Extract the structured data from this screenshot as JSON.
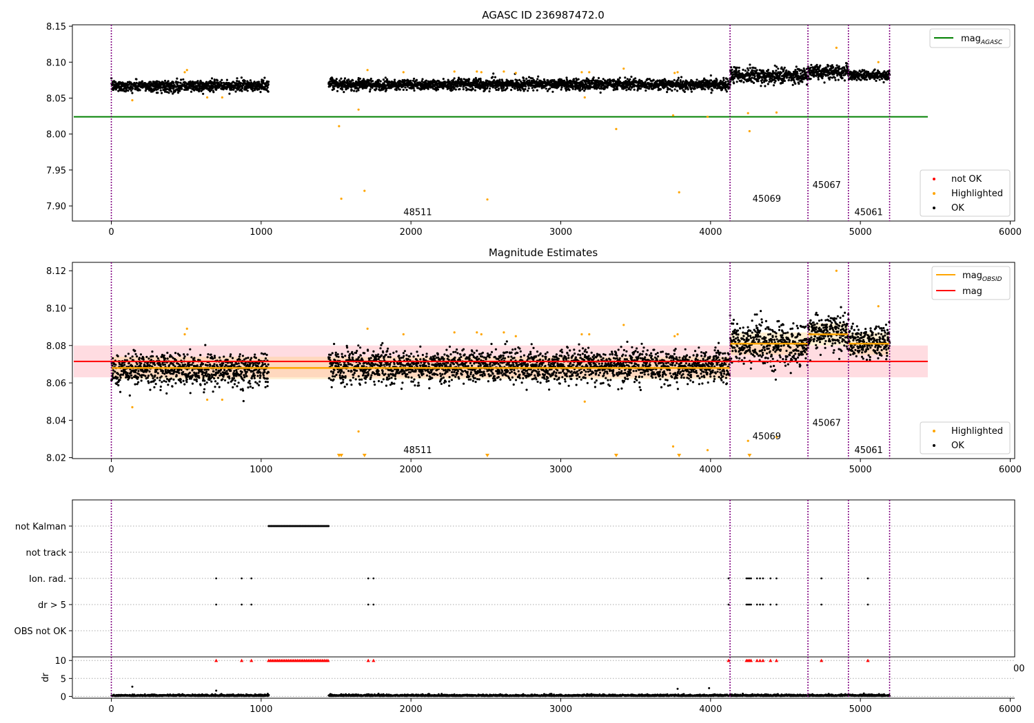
{
  "colors": {
    "ok": "#000000",
    "highlighted": "#ffa500",
    "not_ok": "#ff0000",
    "agasc_line": "#008000",
    "mag_line": "#ff0000",
    "obsid_line": "#ffa500",
    "obs_boundary": "#800080",
    "band": "#ffc0c8"
  },
  "chart_data": [
    {
      "type": "scatter",
      "title": "AGASC ID 236987472.0",
      "xlim": [
        -260,
        6030
      ],
      "ylim": [
        7.879,
        8.152
      ],
      "xticks": [
        0,
        1000,
        2000,
        3000,
        4000,
        5000,
        6000
      ],
      "yticks": [
        7.9,
        7.95,
        8.0,
        8.05,
        8.1,
        8.15
      ],
      "ytick_labels": [
        "7.90",
        "7.95",
        "8.00",
        "8.05",
        "8.10",
        "8.15"
      ],
      "mag_agasc": 8.024,
      "mag_agasc_xrange": [
        -260,
        5450
      ],
      "legend_upper": [
        {
          "label": "mag",
          "sub": "AGASC",
          "kind": "line",
          "color": "#008000"
        }
      ],
      "legend_lower": [
        {
          "label": "not OK",
          "kind": "dot",
          "color": "#ff0000"
        },
        {
          "label": "Highlighted",
          "kind": "dot",
          "color": "#ffa500"
        },
        {
          "label": "OK",
          "kind": "dot",
          "color": "#000000"
        }
      ],
      "observations": [
        {
          "id": "48511",
          "label_x": 1950,
          "label_y": 7.887
        },
        {
          "id": "45069",
          "label_x": 4280,
          "label_y": 7.906
        },
        {
          "id": "45067",
          "label_x": 4680,
          "label_y": 7.925
        },
        {
          "id": "45061",
          "label_x": 4960,
          "label_y": 7.887
        }
      ],
      "segments": [
        {
          "x0": 0,
          "x1": 1050,
          "center": 8.067,
          "spread": 0.007
        },
        {
          "x0": 1450,
          "x1": 4130,
          "center": 8.069,
          "spread": 0.007
        },
        {
          "x0": 4130,
          "x1": 4650,
          "center": 8.081,
          "spread": 0.009
        },
        {
          "x0": 4650,
          "x1": 4920,
          "center": 8.087,
          "spread": 0.008
        },
        {
          "x0": 4920,
          "x1": 5195,
          "center": 8.082,
          "spread": 0.006
        }
      ],
      "highlighted": [
        [
          140,
          8.047
        ],
        [
          490,
          8.086
        ],
        [
          505,
          8.089
        ],
        [
          640,
          8.051
        ],
        [
          740,
          8.051
        ],
        [
          1520,
          8.011
        ],
        [
          1535,
          7.91
        ],
        [
          1650,
          8.034
        ],
        [
          1690,
          7.921
        ],
        [
          1710,
          8.089
        ],
        [
          1950,
          8.086
        ],
        [
          2290,
          8.087
        ],
        [
          2440,
          8.087
        ],
        [
          2470,
          8.086
        ],
        [
          2510,
          7.909
        ],
        [
          2620,
          8.087
        ],
        [
          2700,
          8.085
        ],
        [
          3140,
          8.086
        ],
        [
          3160,
          8.051
        ],
        [
          3190,
          8.086
        ],
        [
          3370,
          8.007
        ],
        [
          3420,
          8.091
        ],
        [
          3750,
          8.026
        ],
        [
          3760,
          8.085
        ],
        [
          3780,
          8.086
        ],
        [
          3790,
          7.919
        ],
        [
          3980,
          8.024
        ],
        [
          4250,
          8.029
        ],
        [
          4260,
          8.004
        ],
        [
          4440,
          8.03
        ],
        [
          4840,
          8.12
        ],
        [
          5120,
          8.1
        ]
      ]
    },
    {
      "type": "scatter",
      "title": "Magnitude Estimates",
      "xlim": [
        -260,
        6030
      ],
      "ylim": [
        8.0195,
        8.1245
      ],
      "xticks": [
        0,
        1000,
        2000,
        3000,
        4000,
        5000,
        6000
      ],
      "yticks": [
        8.02,
        8.04,
        8.06,
        8.08,
        8.1,
        8.12
      ],
      "ytick_labels": [
        "8.02",
        "8.04",
        "8.06",
        "8.08",
        "8.10",
        "8.12"
      ],
      "mag": 8.0715,
      "mag_band": [
        8.063,
        8.08
      ],
      "mag_xrange": [
        -260,
        5450
      ],
      "obsid_mags": [
        {
          "x0": 0,
          "x1": 4130,
          "mag": 8.068
        },
        {
          "x0": 4130,
          "x1": 4650,
          "mag": 8.081
        },
        {
          "x0": 4650,
          "x1": 4920,
          "mag": 8.086
        },
        {
          "x0": 4920,
          "x1": 5195,
          "mag": 8.081
        }
      ],
      "legend_upper": [
        {
          "label": "mag",
          "sub": "OBSID",
          "kind": "line",
          "color": "#ffa500"
        },
        {
          "label": "mag",
          "kind": "line",
          "color": "#ff0000"
        }
      ],
      "legend_lower": [
        {
          "label": "Highlighted",
          "kind": "dot",
          "color": "#ffa500"
        },
        {
          "label": "OK",
          "kind": "dot",
          "color": "#000000"
        }
      ],
      "observations": [
        {
          "id": "48511",
          "label_x": 1950,
          "label_y": 8.0225
        },
        {
          "id": "45069",
          "label_x": 4280,
          "label_y": 8.0298
        },
        {
          "id": "45067",
          "label_x": 4680,
          "label_y": 8.037
        },
        {
          "id": "45061",
          "label_x": 4960,
          "label_y": 8.0225
        }
      ],
      "segments": [
        {
          "x0": 0,
          "x1": 1050,
          "center": 8.067,
          "spread": 0.008
        },
        {
          "x0": 1450,
          "x1": 4130,
          "center": 8.069,
          "spread": 0.008
        },
        {
          "x0": 4130,
          "x1": 4650,
          "center": 8.081,
          "spread": 0.01
        },
        {
          "x0": 4650,
          "x1": 4920,
          "center": 8.087,
          "spread": 0.009
        },
        {
          "x0": 4920,
          "x1": 5195,
          "center": 8.082,
          "spread": 0.007
        }
      ],
      "highlighted": [
        [
          140,
          8.047
        ],
        [
          490,
          8.086
        ],
        [
          505,
          8.089
        ],
        [
          640,
          8.051
        ],
        [
          740,
          8.051
        ],
        [
          1650,
          8.034
        ],
        [
          1710,
          8.089
        ],
        [
          1950,
          8.086
        ],
        [
          2290,
          8.087
        ],
        [
          2440,
          8.087
        ],
        [
          2470,
          8.086
        ],
        [
          2620,
          8.087
        ],
        [
          2700,
          8.085
        ],
        [
          3140,
          8.086
        ],
        [
          3160,
          8.05
        ],
        [
          3190,
          8.086
        ],
        [
          3420,
          8.091
        ],
        [
          3750,
          8.026
        ],
        [
          3760,
          8.085
        ],
        [
          3780,
          8.086
        ],
        [
          3980,
          8.024
        ],
        [
          4250,
          8.029
        ],
        [
          4440,
          8.031
        ],
        [
          4840,
          8.12
        ],
        [
          5120,
          8.101
        ]
      ],
      "clipped_low_x": [
        1520,
        1535,
        1690,
        2510,
        3370,
        3790,
        4260
      ]
    },
    {
      "type": "scatter",
      "xlim": [
        -260,
        6030
      ],
      "flag_categories": [
        "not Kalman",
        "not track",
        "Ion. rad.",
        "dr > 5",
        "OBS not OK"
      ],
      "not_kalman_range": [
        1050,
        1450
      ],
      "ion_rad_x": [
        700,
        870,
        935,
        1715,
        1750,
        4120,
        4240,
        4250,
        4260,
        4270,
        4310,
        4330,
        4350,
        4400,
        4440,
        4740,
        5050
      ],
      "dr_gt5_x": [
        700,
        870,
        935,
        1715,
        1750,
        4120,
        4240,
        4250,
        4260,
        4270,
        4310,
        4330,
        4350,
        4400,
        4440,
        4740,
        5050
      ],
      "obs_not_ok_x": []
    },
    {
      "type": "scatter",
      "xlim": [
        -260,
        6030
      ],
      "ylim": [
        -0.5,
        11.0
      ],
      "ylabel": "dr",
      "yticks": [
        0,
        5,
        10
      ],
      "ytick_labels": [
        "0",
        "5",
        "10"
      ],
      "xticks": [
        0,
        1000,
        2000,
        3000,
        4000,
        5000,
        6000
      ],
      "clip_value": 10,
      "clipped_x_range": [
        1050,
        1450
      ],
      "clipped_x": [
        700,
        870,
        935,
        1715,
        1750,
        4120,
        4240,
        4250,
        4260,
        4270,
        4310,
        4330,
        4350,
        4400,
        4440,
        4740,
        5050
      ],
      "outliers": [
        [
          140,
          2.7
        ],
        [
          700,
          1.6
        ],
        [
          3780,
          2.1
        ],
        [
          3990,
          2.3
        ]
      ],
      "edge_label": "00"
    }
  ],
  "obs_boundaries_x": [
    0,
    4130,
    4650,
    4920,
    5195
  ]
}
